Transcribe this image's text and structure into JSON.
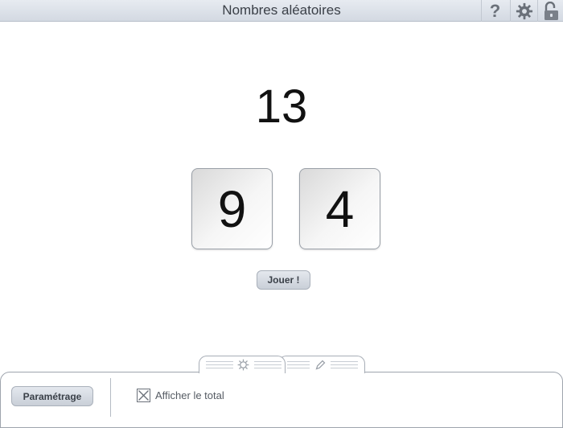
{
  "window": {
    "title": "Nombres aléatoires",
    "icons": [
      "help-icon",
      "gear-icon",
      "unlock-icon"
    ],
    "help_glyph": "?"
  },
  "main": {
    "total": "13",
    "dice": [
      "9",
      "4"
    ],
    "play_label": "Jouer !"
  },
  "bottom_panel": {
    "tabs": [
      {
        "icon": "gear-icon"
      },
      {
        "icon": "pencil-icon"
      }
    ],
    "settings_button_label": "Paramétrage",
    "show_total": {
      "label": "Afficher le total",
      "checked": true
    }
  },
  "colors": {
    "titlebar": "#d3d9e2",
    "button": "#c9cfd8",
    "border": "#9ea4ad"
  }
}
